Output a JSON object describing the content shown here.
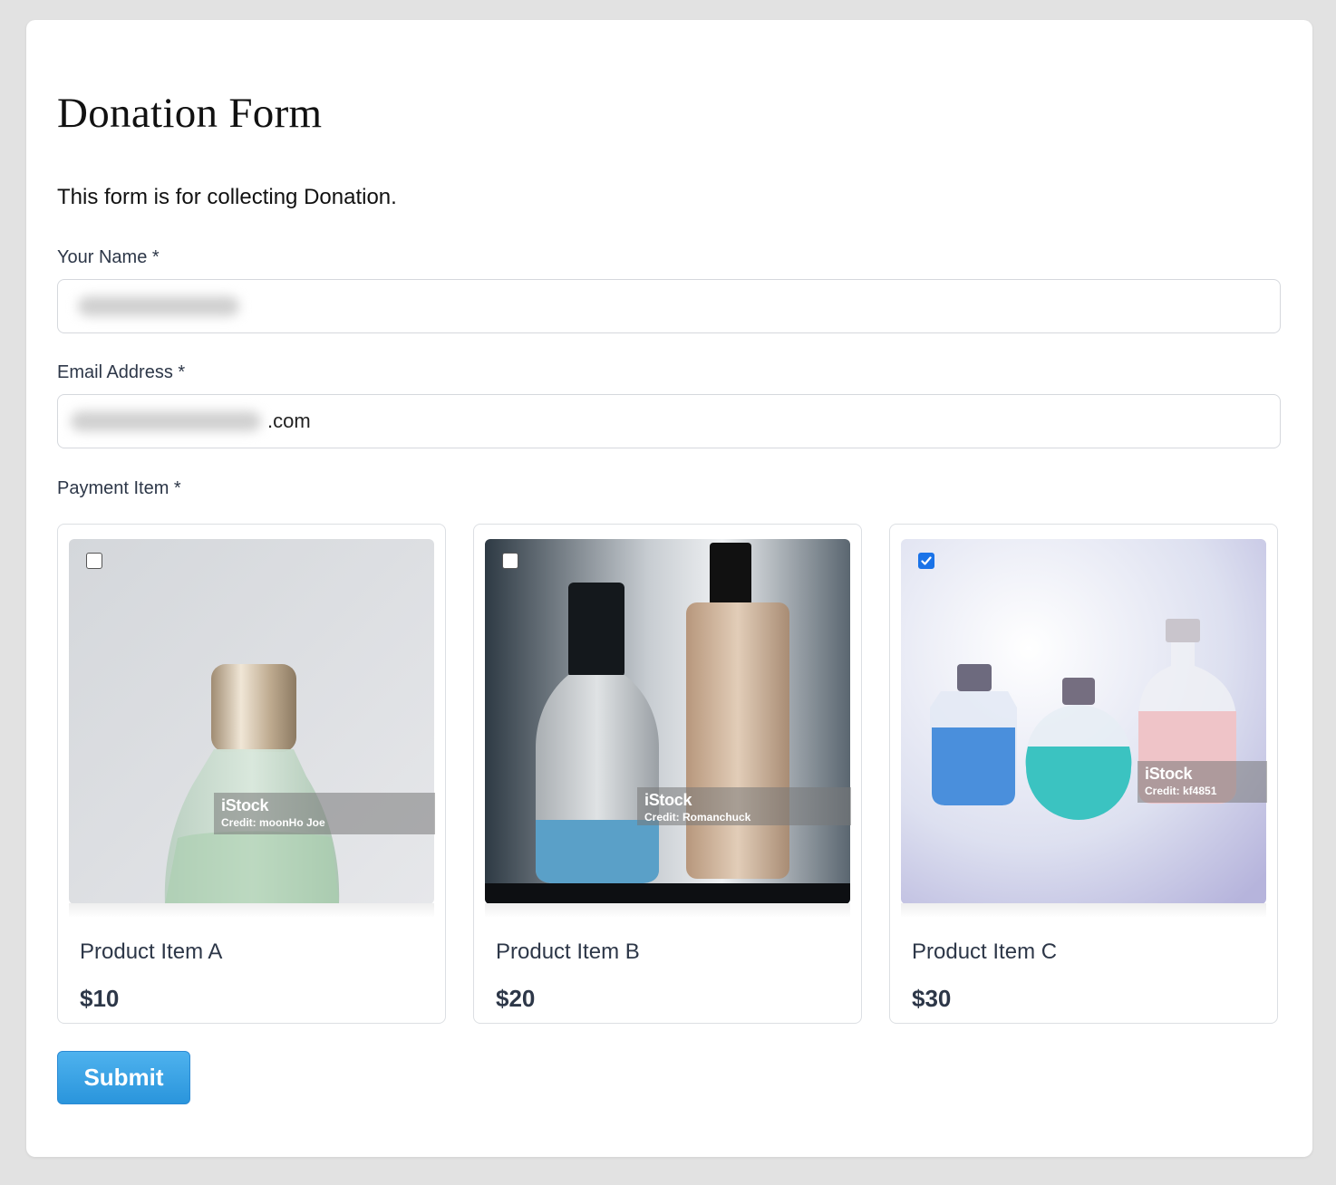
{
  "form": {
    "title": "Donation Form",
    "description": "This form is for collecting Donation.",
    "name_label": "Your Name *",
    "email_label": "Email Address *",
    "email_suffix": ".com",
    "payment_label": "Payment Item *",
    "submit_label": "Submit"
  },
  "products": [
    {
      "name": "Product Item A",
      "price": "$10",
      "checked": false,
      "watermark": "iStock",
      "credit": "Credit: moonHo Joe"
    },
    {
      "name": "Product Item B",
      "price": "$20",
      "checked": false,
      "watermark": "iStock",
      "credit": "Credit: Romanchuck"
    },
    {
      "name": "Product Item C",
      "price": "$30",
      "checked": true,
      "watermark": "iStock",
      "credit": "Credit: kf4851"
    }
  ],
  "colors": {
    "accent": "#2a95dc",
    "checkbox_checked": "#1a73e8"
  }
}
